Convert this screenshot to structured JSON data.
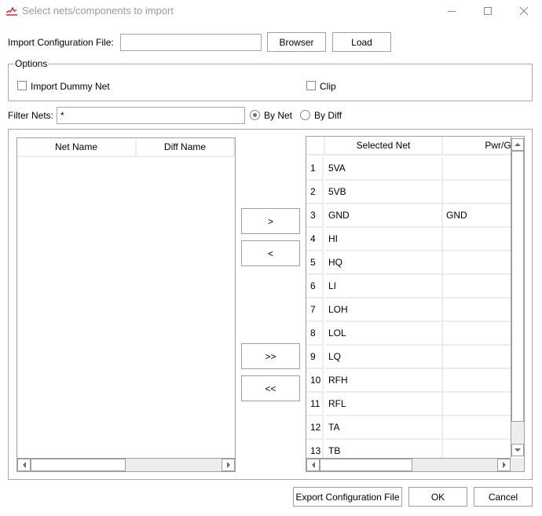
{
  "window": {
    "title": "Select nets/components to import",
    "app_icon": "chart-icon",
    "controls": [
      "minimize-icon",
      "maximize-icon",
      "close-icon"
    ]
  },
  "config": {
    "label": "Import Configuration File:",
    "value": "",
    "browser_label": "Browser",
    "load_label": "Load"
  },
  "options": {
    "legend": "Options",
    "import_dummy_net": {
      "label": "Import Dummy Net",
      "checked": false
    },
    "clip": {
      "label": "Clip",
      "checked": false
    }
  },
  "filter": {
    "label": "Filter Nets:",
    "value": "*",
    "by_net": {
      "label": "By Net",
      "selected": true
    },
    "by_diff": {
      "label": "By Diff",
      "selected": false
    }
  },
  "available_table": {
    "columns": [
      "Net Name",
      "Diff Name"
    ],
    "rows": []
  },
  "transfer": {
    "add_label": ">",
    "remove_label": "<",
    "add_all_label": ">>",
    "remove_all_label": "<<"
  },
  "selected_table": {
    "columns": [
      "Selected Net",
      "Pwr/Gnd"
    ],
    "header_visible_second": "Pwr/Gı",
    "rows": [
      {
        "num": "1",
        "net": "5VA",
        "pwr": ""
      },
      {
        "num": "2",
        "net": "5VB",
        "pwr": ""
      },
      {
        "num": "3",
        "net": "GND",
        "pwr": "GND"
      },
      {
        "num": "4",
        "net": "HI",
        "pwr": ""
      },
      {
        "num": "5",
        "net": "HQ",
        "pwr": ""
      },
      {
        "num": "6",
        "net": "LI",
        "pwr": ""
      },
      {
        "num": "7",
        "net": "LOH",
        "pwr": ""
      },
      {
        "num": "8",
        "net": "LOL",
        "pwr": ""
      },
      {
        "num": "9",
        "net": "LQ",
        "pwr": ""
      },
      {
        "num": "10",
        "net": "RFH",
        "pwr": ""
      },
      {
        "num": "11",
        "net": "RFL",
        "pwr": ""
      },
      {
        "num": "12",
        "net": "TA",
        "pwr": ""
      },
      {
        "num": "13",
        "net": "TB",
        "pwr": ""
      }
    ]
  },
  "footer": {
    "export_label": "Export Configuration File",
    "ok_label": "OK",
    "cancel_label": "Cancel"
  },
  "colors": {
    "icon_red": "#d9282f",
    "border": "#a0a0a0",
    "grid": "#ececec",
    "title_text": "#9a9a9a"
  }
}
